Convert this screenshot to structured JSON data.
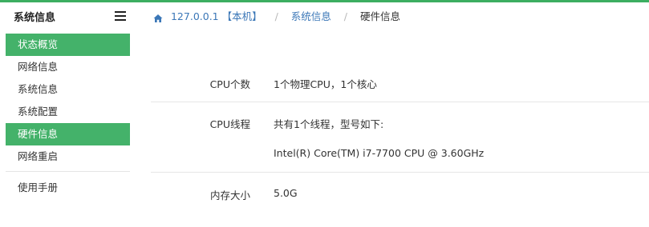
{
  "sidebar": {
    "title": "系统信息",
    "items": [
      {
        "label": "状态概览",
        "active": true
      },
      {
        "label": "网络信息",
        "active": false
      },
      {
        "label": "系统信息",
        "active": false
      },
      {
        "label": "系统配置",
        "active": false
      },
      {
        "label": "硬件信息",
        "active": true
      },
      {
        "label": "网络重启",
        "active": false
      }
    ],
    "footer_item": "使用手册"
  },
  "breadcrumb": {
    "home": "127.0.0.1 【本机】",
    "section": "系统信息",
    "current": "硬件信息",
    "separator": "/"
  },
  "hardware": {
    "cpu_count": {
      "label": "CPU个数",
      "value": "1个物理CPU，1个核心"
    },
    "cpu_threads": {
      "label": "CPU线程",
      "value": "共有1个线程，型号如下:",
      "model": "Intel(R) Core(TM) i7-7700 CPU @ 3.60GHz"
    },
    "memory": {
      "label": "内存大小",
      "value": "5.0G"
    }
  },
  "colors": {
    "accent": "#44b26a",
    "link": "#3b77b7",
    "topbar": "#3cae61"
  }
}
